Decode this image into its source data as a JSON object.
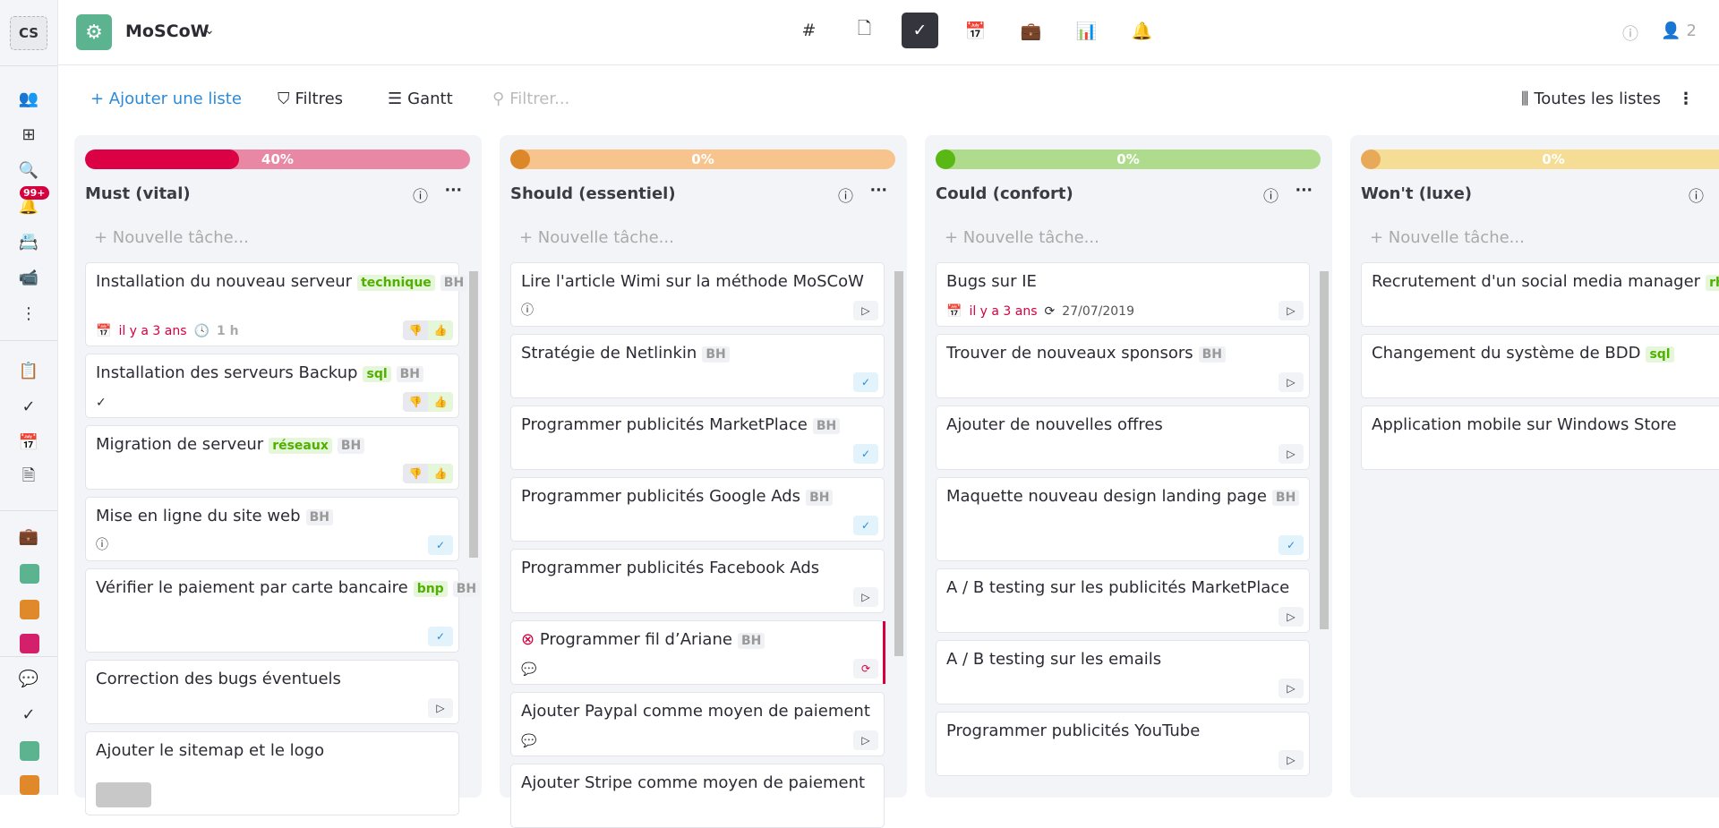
{
  "sidebar": {
    "avatar": "CS",
    "notif_badge": "99+"
  },
  "header": {
    "project": "MoSCoW",
    "users_count": "2"
  },
  "nav": [
    "#",
    "file",
    "check",
    "calendar",
    "briefcase",
    "chart",
    "bell"
  ],
  "toolbar": {
    "add_list": "+ Ajouter une liste",
    "filters": "Filtres",
    "gantt": "Gantt",
    "search_placeholder": "Filtrer...",
    "all_lists": "Toutes les listes"
  },
  "columns": [
    {
      "title": "Must (vital)",
      "progress": "40%",
      "progress_value": 40,
      "new_task": "Nouvelle tâche...",
      "colors": {
        "track": "#e888a4",
        "fill": "#dc0045"
      },
      "cards": [
        {
          "title": "Installation du nouveau serveur",
          "tags": [
            "technique"
          ],
          "user": "BH",
          "due": "il y a 3 ans",
          "duration": "1 h",
          "votes": true
        },
        {
          "title": "Installation des serveurs Backup",
          "tags": [
            "sql"
          ],
          "user": "BH",
          "votes": true,
          "check": true
        },
        {
          "title": "Migration de serveur",
          "tags": [
            "réseaux"
          ],
          "user": "BH",
          "votes": true
        },
        {
          "title": "Mise en ligne du site web",
          "user": "BH",
          "info": true,
          "action": "done"
        },
        {
          "title": "Vérifier le paiement par carte bancaire",
          "tags": [
            "bnp"
          ],
          "user": "BH",
          "action": "done"
        },
        {
          "title": "Correction des bugs éventuels",
          "action": "play"
        },
        {
          "title": "Ajouter le sitemap et le logo",
          "thumb": true
        }
      ]
    },
    {
      "title": "Should (essentiel)",
      "progress": "0%",
      "progress_value": 0,
      "new_task": "Nouvelle tâche...",
      "colors": {
        "track": "#f8c48e",
        "fill": "#dc8828"
      },
      "cards": [
        {
          "title": "Lire l'article Wimi sur la méthode MoSCoW",
          "info": true,
          "action": "play"
        },
        {
          "title": "Stratégie de Netlinkin",
          "user": "BH",
          "action": "done"
        },
        {
          "title": "Programmer publicités MarketPlace",
          "user": "BH",
          "action": "done"
        },
        {
          "title": "Programmer publicités Google Ads",
          "user": "BH",
          "action": "done"
        },
        {
          "title": "Programmer publicités Facebook Ads",
          "action": "play"
        },
        {
          "title": "Programmer fil d’Ariane",
          "user": "BH",
          "blocked": true,
          "comments": true,
          "action": "repeat"
        },
        {
          "title": "Ajouter Paypal comme moyen de paiement",
          "comments": true,
          "action": "play"
        },
        {
          "title": "Ajouter Stripe comme moyen de paiement"
        }
      ]
    },
    {
      "title": "Could (confort)",
      "progress": "0%",
      "progress_value": 0,
      "new_task": "Nouvelle tâche...",
      "colors": {
        "track": "#afdb8d",
        "fill": "#5ab814"
      },
      "cards": [
        {
          "title": "Bugs sur IE",
          "due": "il y a 3 ans",
          "recurring": "27/07/2019",
          "action": "play"
        },
        {
          "title": "Trouver de nouveaux sponsors",
          "user": "BH",
          "action": "play"
        },
        {
          "title": "Ajouter de nouvelles offres",
          "action": "play"
        },
        {
          "title": "Maquette nouveau design landing page",
          "user": "BH",
          "action": "done"
        },
        {
          "title": "A / B testing sur les publicités MarketPlace",
          "action": "play"
        },
        {
          "title": "A / B testing sur les emails",
          "action": "play"
        },
        {
          "title": "Programmer publicités YouTube",
          "action": "play"
        }
      ]
    },
    {
      "title": "Won't (luxe)",
      "progress": "0%",
      "progress_value": 0,
      "new_task": "Nouvelle tâche...",
      "colors": {
        "track": "#f5dd95",
        "fill": "#e8aa58"
      },
      "cards": [
        {
          "title": "Recrutement d'un social media manager",
          "tags": [
            "rh"
          ]
        },
        {
          "title": "Changement du système de BDD",
          "tags": [
            "sql"
          ]
        },
        {
          "title": "Application mobile sur Windows Store"
        }
      ]
    }
  ]
}
